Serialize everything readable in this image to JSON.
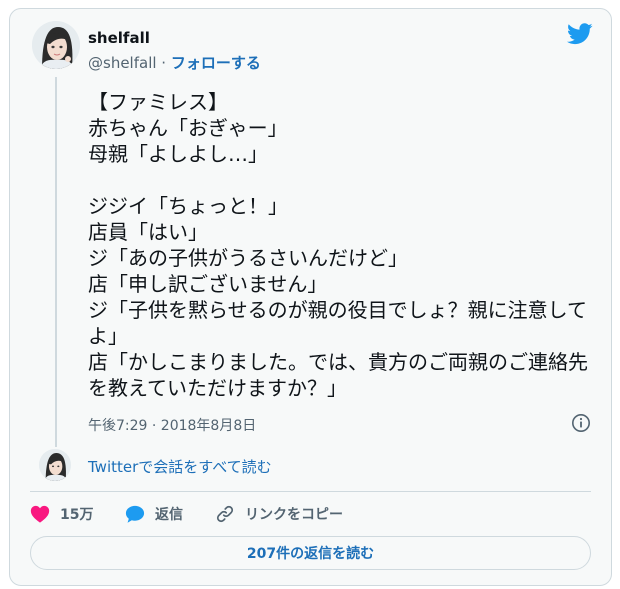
{
  "author": {
    "display_name": "shelfall",
    "handle": "@shelfall",
    "separator": " · ",
    "follow_label": "フォローする"
  },
  "tweet": {
    "text": "【ファミレス】\n赤ちゃん「おぎゃー」\n母親「よしよし…」\n\nジジイ「ちょっと！」\n店員「はい」\nジ「あの子供がうるさいんだけど」\n店「申し訳ございません」\nジ「子供を黙らせるのが親の役目でしょ？親に注意してよ」\n店「かしこまりました。では、貴方のご両親のご連絡先を教えていただけますか？」",
    "timestamp": "午後7:29 · 2018年8月8日"
  },
  "conversation": {
    "link_label": "Twitterで会話をすべて読む"
  },
  "actions": {
    "like_count": "15万",
    "reply_label": "返信",
    "copy_link_label": "リンクをコピー"
  },
  "footer": {
    "read_replies_label": "207件の返信を読む"
  },
  "icons": {
    "brand": "twitter-bird-icon",
    "info": "info-icon",
    "like": "heart-icon",
    "reply": "speech-bubble-icon",
    "link": "chain-link-icon"
  },
  "colors": {
    "brand_blue": "#1d9bf0",
    "link_blue": "#1d6fb8",
    "like_pink": "#f91880",
    "text": "#0f1419",
    "muted": "#536471",
    "border": "#cfd9de",
    "background": "#f7f9f9"
  }
}
